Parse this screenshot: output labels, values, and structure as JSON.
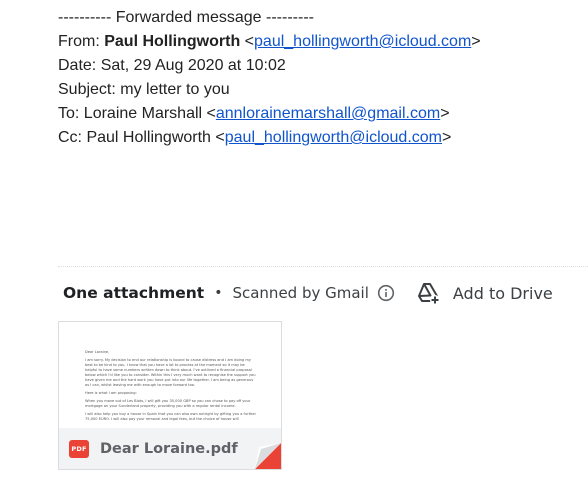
{
  "email": {
    "forward_header": "---------- Forwarded message ---------",
    "from_label": "From: ",
    "from_name": "Paul Hollingworth",
    "from_email": "paul_hollingworth@icloud.com",
    "date_line": "Date: Sat, 29 Aug 2020 at 10:02",
    "subject_line": "Subject: my letter to you",
    "to_label": "To: Loraine Marshall <",
    "to_email": "annlorainemarshall@gmail.com",
    "cc_label": "Cc: Paul Hollingworth <",
    "cc_email": "paul_hollingworth@icloud.com",
    "lt": " <",
    "gt": ">"
  },
  "attachments_bar": {
    "title": "One attachment",
    "separator": "•",
    "scanned_text": "Scanned by Gmail",
    "info_icon": "info-icon",
    "drive_icon": "add-to-drive-icon",
    "drive_label": "Add to Drive"
  },
  "attachment": {
    "file_name": "Dear Loraine.pdf",
    "type_badge": "PDF",
    "type_color": "#ea4335",
    "preview_paragraphs": [
      "Dear Loraine,",
      "I am sorry. My decision to end our relationship is bound to cause distress and I am doing my best to be kind to you. I know that you have a lot to process at the moment so it may be helpful to have some numbers written down to think about. I've outlined a financial proposal below which I'd like you to consider. Within this I very much want to recognise the support you have given me and the hard work you have put into our life together. I am being as generous as I can, whilst leaving me with enough to move forward too.",
      "Here is what I am proposing:",
      "When you move out of Les Biots, I will gift you 35,000 GBP so you can chose to pay off your mortgage on your Sunderland property, providing you with a regular rental income.",
      "I will also help you buy a house in Spain that you can also own outright by gifting you a further 75,000 EURO. I will also pay your removal and legal fees, but the choice of house will"
    ]
  },
  "colors": {
    "link": "#1155cc",
    "text": "#222222",
    "muted": "#5f6368",
    "pdf_red": "#ea4335"
  }
}
